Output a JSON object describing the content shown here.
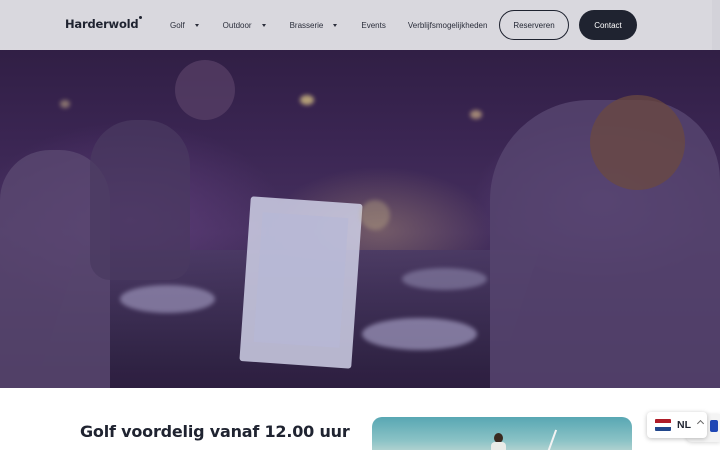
{
  "header": {
    "logo_text": "Harderwold",
    "nav": [
      {
        "label": "Golf",
        "has_dropdown": true
      },
      {
        "label": "Outdoor",
        "has_dropdown": true
      },
      {
        "label": "Brasserie",
        "has_dropdown": true
      },
      {
        "label": "Events",
        "has_dropdown": false
      },
      {
        "label": "Verblijfsmogelijkheden",
        "has_dropdown": false
      }
    ],
    "reserve_label": "Reserveren",
    "contact_label": "Contact"
  },
  "main": {
    "headline": "Golf voordelig vanaf 12.00 uur"
  },
  "language": {
    "code": "NL",
    "flag_colors": [
      "#ae1c28",
      "#ffffff",
      "#21468b"
    ]
  },
  "colors": {
    "primary_dark": "#1f2330",
    "header_bg": "#e8e8ec"
  }
}
